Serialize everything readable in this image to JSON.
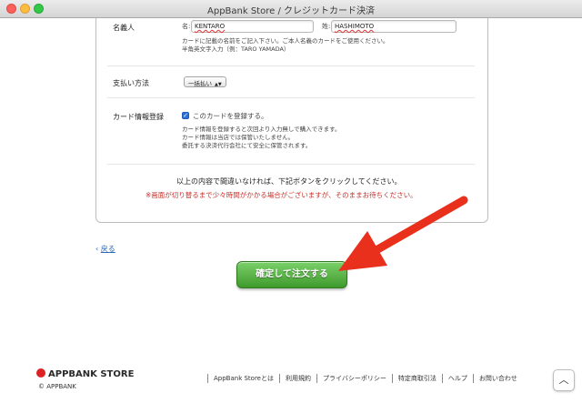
{
  "window": {
    "title": "AppBank Store / クレジットカード決済"
  },
  "form": {
    "name_row": {
      "label": "名義人",
      "first_prefix": "名:",
      "first_value": "KENTARO",
      "last_prefix": "姓:",
      "last_value": "HASHIMOTO",
      "help_line1": "カードに記載の名前をご記入下さい。ご本人名義のカードをご使用ください。",
      "help_line2": "半角英文字入力（例：TARO YAMADA）"
    },
    "payment_row": {
      "label": "支払い方法",
      "select_value": "一括払い"
    },
    "register_row": {
      "label": "カード情報登録",
      "checkbox_label": "このカードを登録する。",
      "checkbox_checked": true,
      "help_line1": "カード情報を登録すると次回より入力無しで購入できます。",
      "help_line2": "カード情報は当店では保管いたしません。",
      "help_line3": "委託する決済代行会社にて安全に保管されます。"
    },
    "confirm_text": "以上の内容で間違いなければ、下記ボタンをクリックしてください。",
    "warning_text": "※画面が切り替るまで少々時間がかかる場合がございますが、そのままお待ちください。"
  },
  "back_link": {
    "icon": "chevron-left-icon",
    "label": "戻る"
  },
  "order_button": {
    "label": "確定して注文する"
  },
  "annotation": {
    "arrow_color": "#e8301c"
  },
  "footer": {
    "logo_text": "APPBANK STORE",
    "copyright": "© APPBANK",
    "links": [
      "AppBank Storeとは",
      "利用規約",
      "プライバシーポリシー",
      "特定商取引法",
      "ヘルプ",
      "お問い合わせ"
    ],
    "top_button_icon": "chevron-up-icon"
  },
  "colors": {
    "accent_green": "#3f9a2c",
    "link_blue": "#2b6ab5",
    "warning_red": "#c8302a"
  }
}
